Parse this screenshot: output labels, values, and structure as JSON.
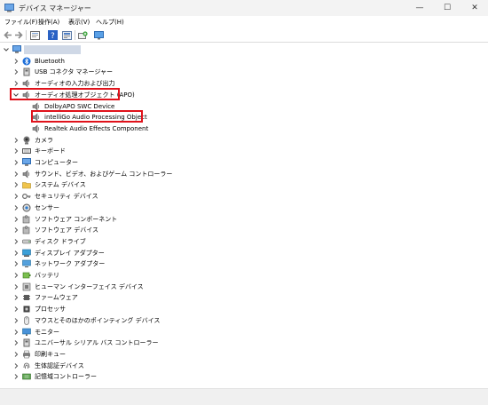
{
  "window": {
    "title": "デバイス マネージャー",
    "minimize": "—",
    "maximize": "☐",
    "close": "✕"
  },
  "menu": [
    "ファイル(F)",
    "操作(A)",
    "表示(V)",
    "ヘルプ(H)"
  ],
  "toolbar": [
    "back-icon",
    "forward-icon",
    "properties-icon",
    "help-icon",
    "update-driver-icon",
    "scan-hardware-icon",
    "monitor-icon"
  ],
  "root": {
    "label": "",
    "icon": "computer-icon",
    "expanded": true
  },
  "tree": [
    {
      "label": "Bluetooth",
      "icon": "bluetooth-icon",
      "expanded": false
    },
    {
      "label": "USB コネクタ マネージャー",
      "icon": "usb-icon",
      "expanded": false
    },
    {
      "label": "オーディオの入力および出力",
      "icon": "speaker-icon",
      "expanded": false
    },
    {
      "label": "オーディオ処理オブジェクト (APO)",
      "icon": "speaker-icon",
      "expanded": true,
      "highlighted": true,
      "children": [
        {
          "label": "DolbyAPO SWC Device",
          "icon": "speaker-icon"
        },
        {
          "label": "intelliGo Audio Processing Object",
          "icon": "speaker-icon",
          "highlighted": true
        },
        {
          "label": "Realtek Audio Effects Component",
          "icon": "speaker-icon"
        }
      ]
    },
    {
      "label": "カメラ",
      "icon": "camera-icon",
      "expanded": false
    },
    {
      "label": "キーボード",
      "icon": "keyboard-icon",
      "expanded": false
    },
    {
      "label": "コンピューター",
      "icon": "computer-icon",
      "expanded": false
    },
    {
      "label": "サウンド、ビデオ、およびゲーム コントローラー",
      "icon": "speaker-icon",
      "expanded": false
    },
    {
      "label": "システム デバイス",
      "icon": "folder-icon",
      "expanded": false
    },
    {
      "label": "セキュリティ デバイス",
      "icon": "key-icon",
      "expanded": false
    },
    {
      "label": "センサー",
      "icon": "sensor-icon",
      "expanded": false
    },
    {
      "label": "ソフトウェア コンポーネント",
      "icon": "puzzle-icon",
      "expanded": false
    },
    {
      "label": "ソフトウェア デバイス",
      "icon": "puzzle-icon",
      "expanded": false
    },
    {
      "label": "ディスク ドライブ",
      "icon": "disk-icon",
      "expanded": false
    },
    {
      "label": "ディスプレイ アダプター",
      "icon": "display-icon",
      "expanded": false
    },
    {
      "label": "ネットワーク アダプター",
      "icon": "network-icon",
      "expanded": false
    },
    {
      "label": "バッテリ",
      "icon": "battery-icon",
      "expanded": false
    },
    {
      "label": "ヒューマン インターフェイス デバイス",
      "icon": "hid-icon",
      "expanded": false
    },
    {
      "label": "ファームウェア",
      "icon": "chip-icon",
      "expanded": false
    },
    {
      "label": "プロセッサ",
      "icon": "processor-icon",
      "expanded": false
    },
    {
      "label": "マウスとそのほかのポインティング デバイス",
      "icon": "mouse-icon",
      "expanded": false
    },
    {
      "label": "モニター",
      "icon": "monitor-icon",
      "expanded": false
    },
    {
      "label": "ユニバーサル シリアル バス コントローラー",
      "icon": "usb-icon",
      "expanded": false
    },
    {
      "label": "印刷キュー",
      "icon": "printer-icon",
      "expanded": false
    },
    {
      "label": "生体認証デバイス",
      "icon": "fingerprint-icon",
      "expanded": false
    },
    {
      "label": "記憶域コントローラー",
      "icon": "storage-icon",
      "expanded": false
    }
  ],
  "colors": {
    "highlight": "#e0121b",
    "accent": "#1e6fd9"
  }
}
